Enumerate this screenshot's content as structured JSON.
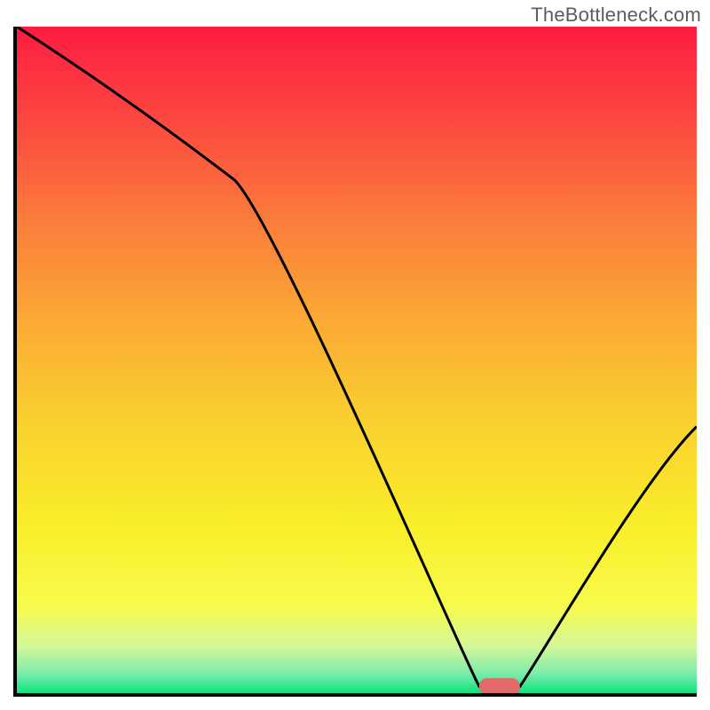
{
  "watermark": "TheBottleneck.com",
  "chart_data": {
    "type": "line",
    "title": "",
    "xlabel": "",
    "ylabel": "",
    "xlim": [
      0,
      100
    ],
    "ylim": [
      0,
      100
    ],
    "x": [
      0,
      32,
      68,
      74,
      100
    ],
    "values": [
      100,
      77,
      1,
      1,
      40
    ],
    "marker": {
      "x": 71,
      "y": 1,
      "color": "#e26a6a",
      "width": 6,
      "height": 2.5,
      "rx": 1.2
    },
    "background_gradient": {
      "stops": [
        {
          "offset": 0.0,
          "color": "#fd1b3f"
        },
        {
          "offset": 0.05,
          "color": "#fd2c42"
        },
        {
          "offset": 0.15,
          "color": "#fc4b3f"
        },
        {
          "offset": 0.3,
          "color": "#fb7f3b"
        },
        {
          "offset": 0.45,
          "color": "#fbac35"
        },
        {
          "offset": 0.6,
          "color": "#fad22e"
        },
        {
          "offset": 0.75,
          "color": "#f9ee2a"
        },
        {
          "offset": 0.87,
          "color": "#f7fb4b"
        },
        {
          "offset": 0.93,
          "color": "#d4f79a"
        },
        {
          "offset": 0.97,
          "color": "#7eedad"
        },
        {
          "offset": 1.0,
          "color": "#0be47f"
        }
      ]
    },
    "line_color": "#000000",
    "line_width": 3
  }
}
